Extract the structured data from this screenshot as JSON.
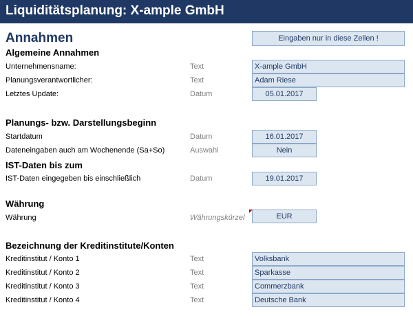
{
  "header": {
    "title": "Liquiditätsplanung: X-ample GmbH"
  },
  "page": {
    "heading": "Annahmen",
    "hint": "Eingaben nur in diese Zellen !"
  },
  "general": {
    "heading": "Algemeine Annahmen",
    "rows": [
      {
        "label": "Unternehmensname:",
        "type": "Text",
        "value": "X-ample GmbH"
      },
      {
        "label": "Planungsverantwortlicher:",
        "type": "Text",
        "value": "Adam Riese"
      },
      {
        "label": "Letztes Update:",
        "type": "Datum",
        "value": "05.01.2017"
      }
    ]
  },
  "planning": {
    "heading": "Planungs- bzw. Darstellungsbeginn",
    "rows": [
      {
        "label": "Startdatum",
        "type": "Datum",
        "value": "16.01.2017"
      },
      {
        "label": "Dateneingaben auch am Wochenende (Sa+So)",
        "type": "Auswahl",
        "value": "Nein"
      }
    ]
  },
  "ist": {
    "heading": "IST-Daten bis zum",
    "rows": [
      {
        "label": "IST-Daten eingegeben bis einschließlich",
        "type": "Datum",
        "value": "19.01.2017"
      }
    ]
  },
  "currency": {
    "heading": "Währung",
    "rows": [
      {
        "label": "Währung",
        "type": "Währungskürzel",
        "value": "EUR"
      }
    ]
  },
  "banks": {
    "heading": "Bezeichnung der Kreditinstitute/Konten",
    "rows": [
      {
        "label": "Kreditinstitut / Konto 1",
        "type": "Text",
        "value": "Volksbank"
      },
      {
        "label": "Kreditinstitut / Konto 2",
        "type": "Text",
        "value": "Sparkasse"
      },
      {
        "label": "Kreditinstitut / Konto 3",
        "type": "Text",
        "value": "Commerzbank"
      },
      {
        "label": "Kreditinstitut / Konto 4",
        "type": "Text",
        "value": "Deutsche Bank"
      }
    ]
  }
}
